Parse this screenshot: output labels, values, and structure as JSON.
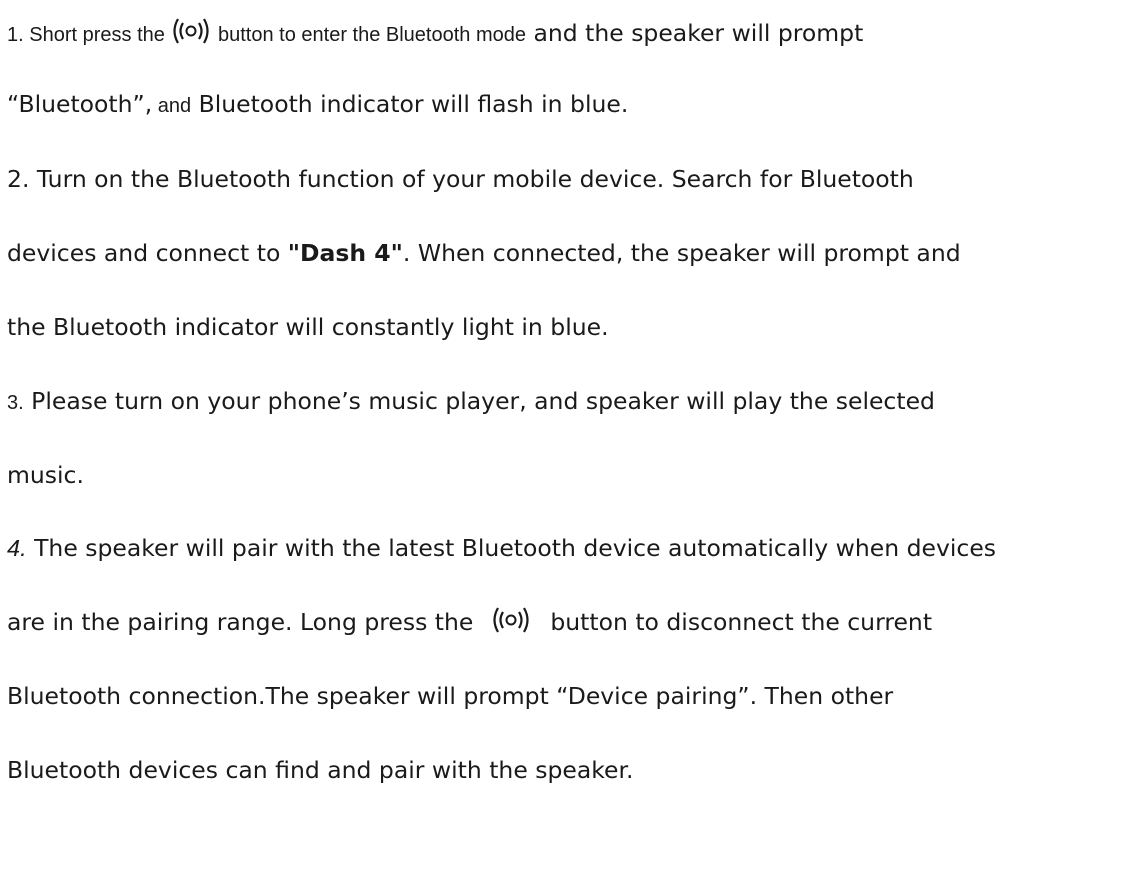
{
  "item1": {
    "number": "1.",
    "pre": "Short press the",
    "post_small": "button to enter the Bluetooth mode",
    "post": " and the speaker will prompt",
    "line2_pre": "“Bluetooth”,",
    "line2_small": " and",
    "line2_post": " Bluetooth indicator will flash in blue."
  },
  "item2": {
    "line1": "2.  Turn on the Bluetooth function of your mobile device. Search for Bluetooth",
    "line2_pre": "devices and connect to ",
    "device_name": "\"Dash 4\"",
    "line2_post": ". When connected, the speaker will prompt and",
    "line3": "the Bluetooth indicator will constantly light in blue."
  },
  "item3": {
    "number": "3.",
    "line1": "  Please turn on your phone’s music player, and speaker will play the selected",
    "line2": "music."
  },
  "item4": {
    "number": "4.",
    "line1": "  The speaker will pair with the latest Bluetooth device automatically when devices",
    "line2_pre": "are in the pairing range. Long press the",
    "line2_post": "button to disconnect the current",
    "line3": "Bluetooth connection.The speaker will prompt  “Device pairing”. Then other",
    "line4": "Bluetooth devices can find and pair with the speaker."
  },
  "icons": {
    "bluetooth_button": "radio-waves-button-icon"
  }
}
